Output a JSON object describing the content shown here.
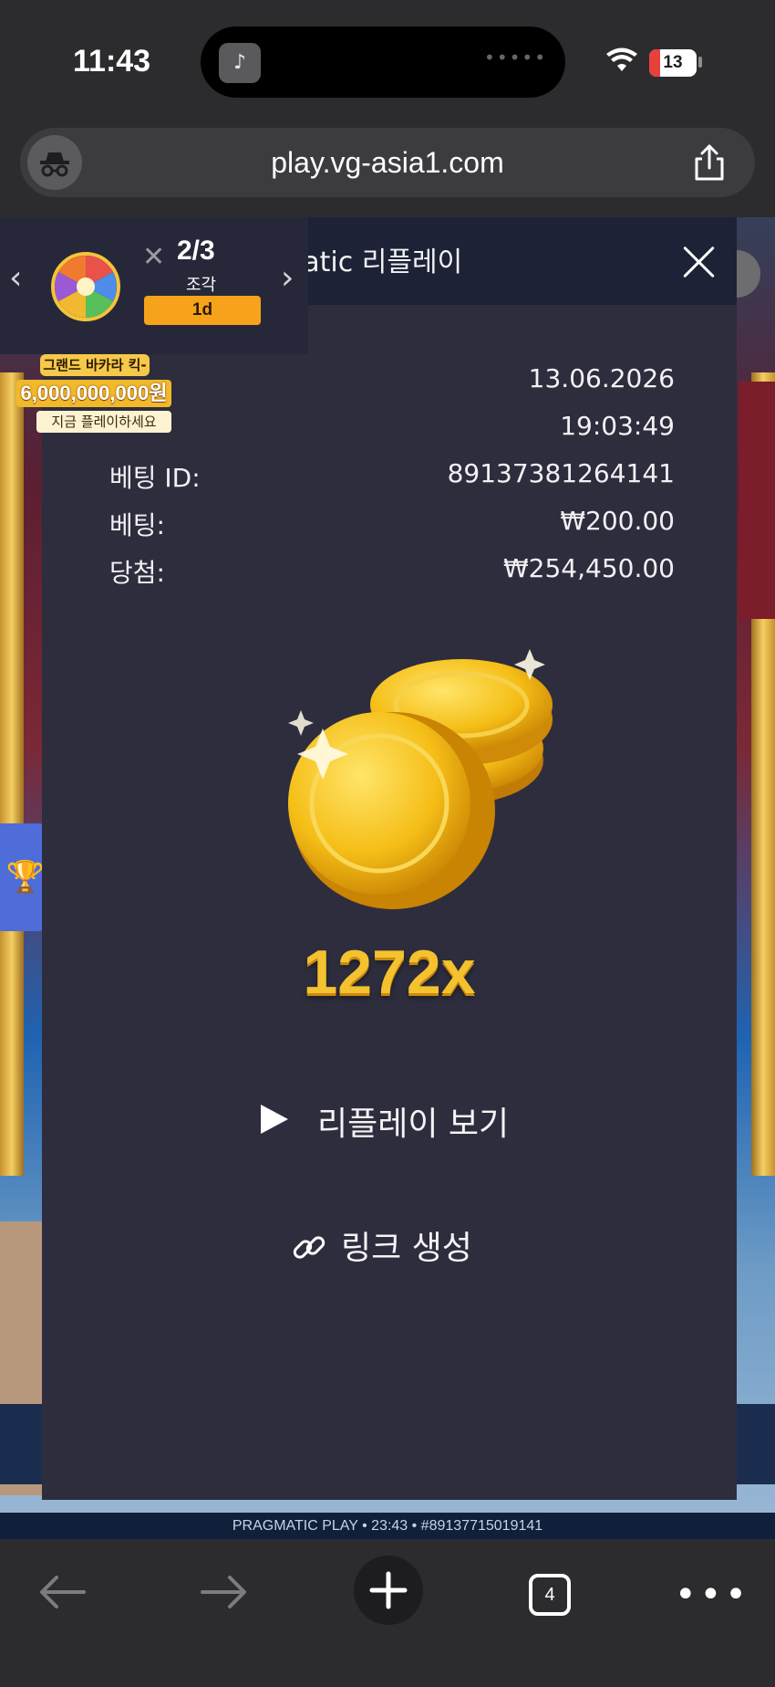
{
  "status_bar": {
    "time": "11:43",
    "battery": "13"
  },
  "browser": {
    "url": "play.vg-asia1.com",
    "open_tabs": "4"
  },
  "widget": {
    "counter": "2/3",
    "counter_sub": "조각",
    "timer": "1d"
  },
  "promo": {
    "title": "그랜드 바카라 킥-오프",
    "amount": "6,000,000,000원",
    "cta": "지금 플레이하세요"
  },
  "panel": {
    "title": "gmatic 리플레이",
    "date_value": "13.06.2026",
    "time_value": "19:03:49",
    "bet_id_label": "베팅 ID:",
    "bet_id_value": "89137381264141",
    "bet_label": "베팅:",
    "bet_value": "₩200.00",
    "win_label": "당첨:",
    "win_value": "₩254,450.00",
    "multiplier": "1272x",
    "watch_replay": "리플레이 보기",
    "create_link": "링크 생성"
  },
  "game_footer": "PRAGMATIC PLAY • 23:43 • #89137715019141",
  "colors": {
    "panel_bg": "#2e2d3d",
    "header_bg": "#1d2236",
    "gold": "#f4c22e",
    "badge_orange": "#f7a21b"
  }
}
